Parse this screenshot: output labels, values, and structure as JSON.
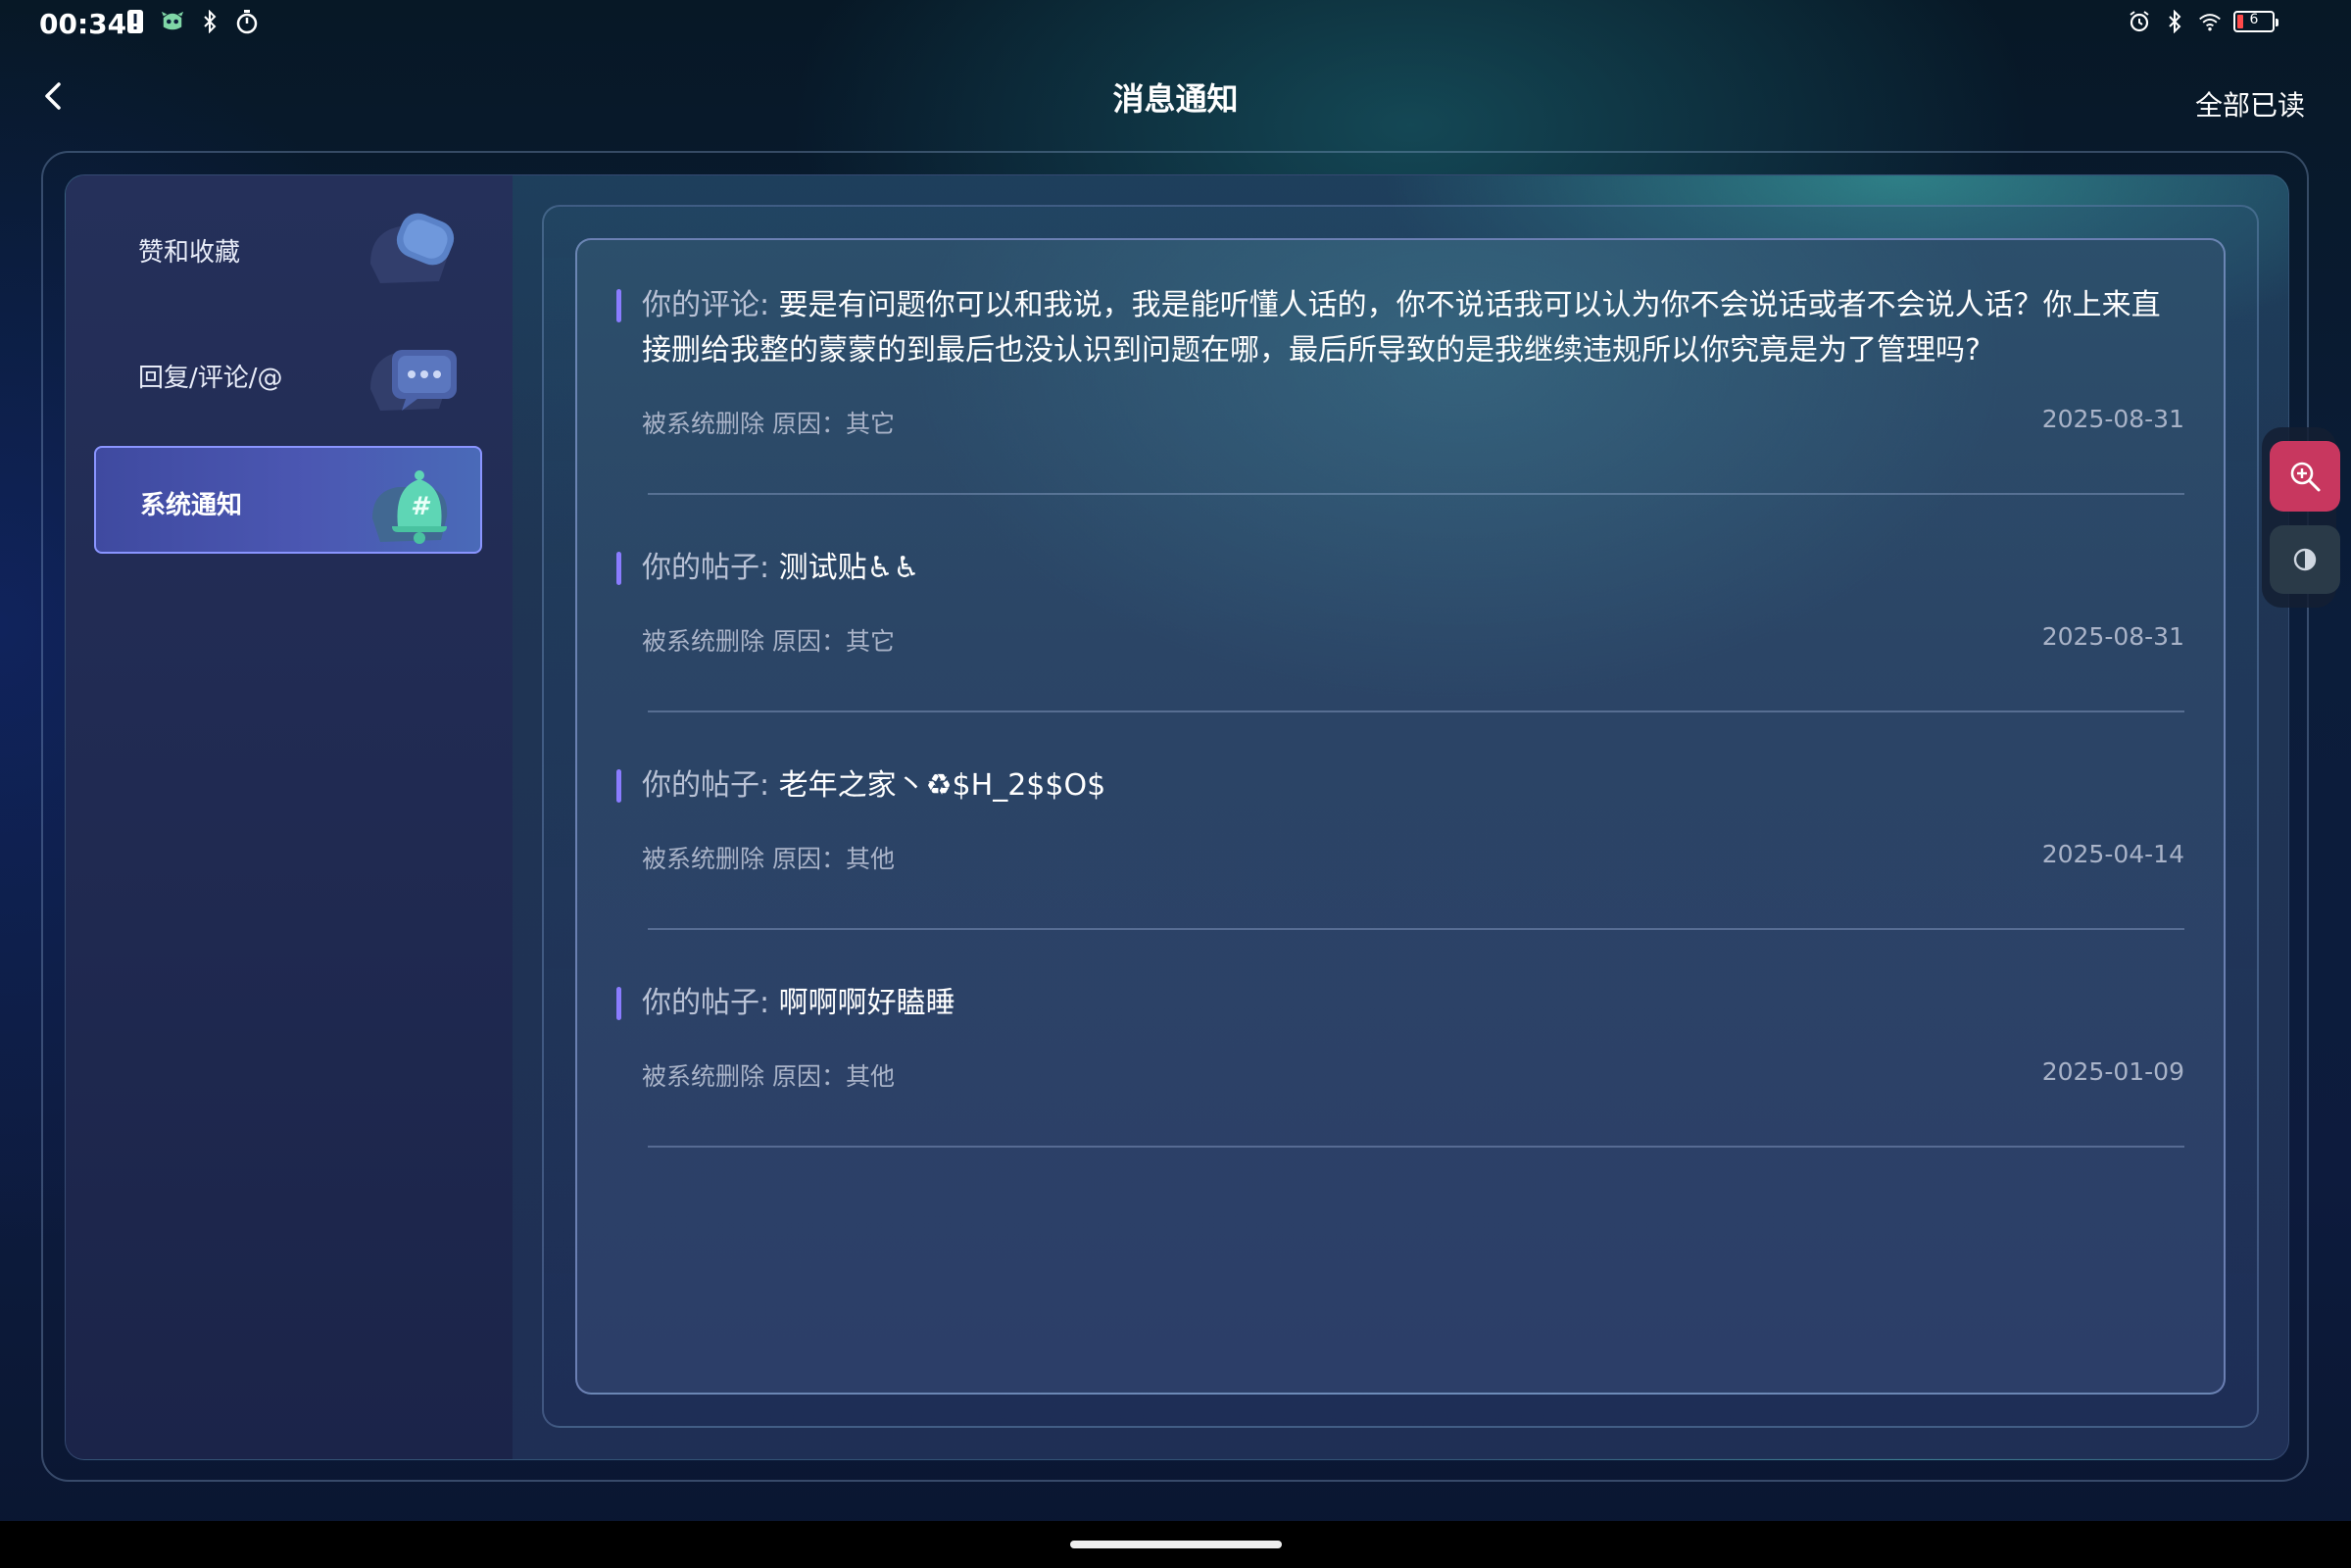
{
  "status_bar": {
    "time": "00:34",
    "left_icons": [
      "alert-icon",
      "app-notification-icon",
      "bluetooth-icon",
      "timer-icon"
    ],
    "right_icons": [
      "alarm-icon",
      "bluetooth-icon",
      "wifi-icon"
    ],
    "battery_level": "6"
  },
  "header": {
    "title": "消息通知",
    "mark_all_read": "全部已读"
  },
  "sidebar": {
    "items": [
      {
        "label": "赞和收藏",
        "icon": "like-tag-icon"
      },
      {
        "label": "回复/评论/@",
        "icon": "chat-bubble-icon"
      },
      {
        "label": "系统通知",
        "icon": "bell-icon",
        "active": true
      }
    ]
  },
  "messages": [
    {
      "prefix": "你的评论:",
      "content": "要是有问题你可以和我说，我是能听懂人话的，你不说话我可以认为你不会说话或者不会说人话？你上来直接删给我整的蒙蒙的到最后也没认识到问题在哪，最后所导致的是我继续违规所以你究竟是为了管理吗?",
      "meta": "被系统删除  原因：其它",
      "date": "2025-08-31"
    },
    {
      "prefix": "你的帖子:",
      "content": "测试贴♿♿",
      "meta": "被系统删除  原因：其它",
      "date": "2025-08-31"
    },
    {
      "prefix": "你的帖子:",
      "content": "老年之家丶♻$H_2$$O$",
      "meta": "被系统删除  原因：其他",
      "date": "2025-04-14"
    },
    {
      "prefix": "你的帖子:",
      "content": "啊啊啊好瞌睡",
      "meta": "被系统删除  原因：其他",
      "date": "2025-01-09"
    }
  ],
  "floating_tools": [
    "zoom-icon",
    "contrast-icon"
  ],
  "colors": {
    "accent": "#8a7cff",
    "active_tab": "#4b57b2",
    "zoom_button": "#c8375f"
  }
}
